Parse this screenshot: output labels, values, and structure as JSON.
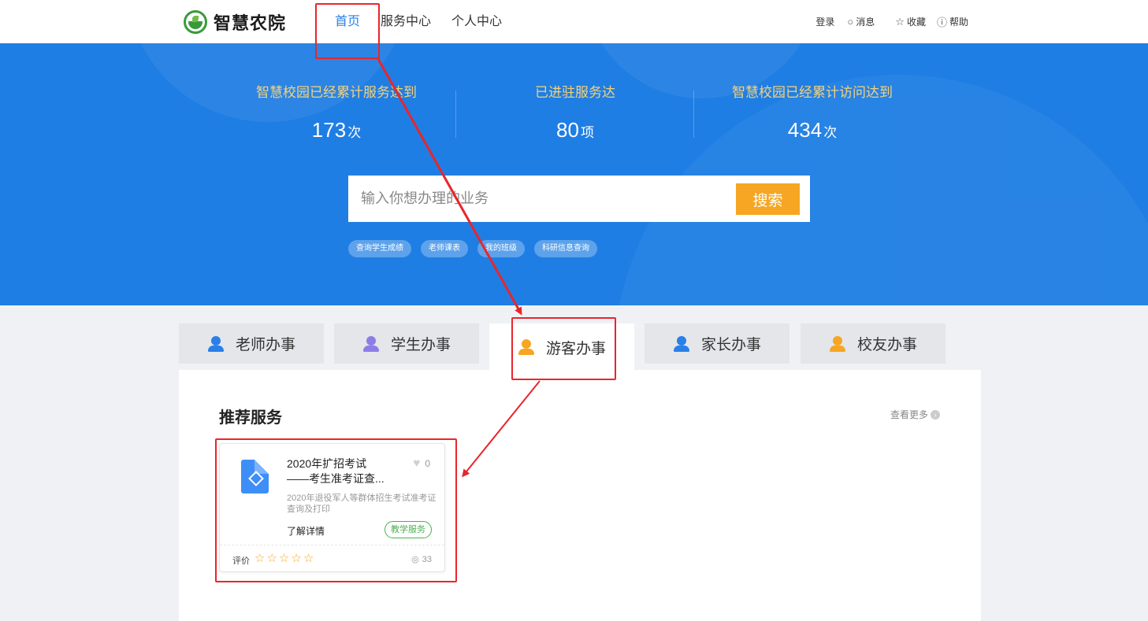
{
  "header": {
    "brand": "智慧农院",
    "nav": [
      "首页",
      "服务中心",
      "个人中心"
    ],
    "active_nav": 0,
    "tools": {
      "login": "登录",
      "message": "消息",
      "favorite": "收藏",
      "help": "帮助"
    }
  },
  "hero": {
    "stats": [
      {
        "label": "智慧校园已经累计服务达到",
        "value": "173",
        "unit": "次"
      },
      {
        "label": "已进驻服务达",
        "value": "80",
        "unit": "项"
      },
      {
        "label": "智慧校园已经累计访问达到",
        "value": "434",
        "unit": "次"
      }
    ],
    "search": {
      "placeholder": "输入你想办理的业务",
      "button": "搜索"
    },
    "tags": [
      "查询学生成绩",
      "老师课表",
      "我的班级",
      "科研信息查询"
    ]
  },
  "tabs": [
    {
      "label": "老师办事",
      "icon": "teacher-icon",
      "color": "blue"
    },
    {
      "label": "学生办事",
      "icon": "student-icon",
      "color": "purple"
    },
    {
      "label": "游客办事",
      "icon": "visitor-icon",
      "color": "orange"
    },
    {
      "label": "家长办事",
      "icon": "parent-icon",
      "color": "blue"
    },
    {
      "label": "校友办事",
      "icon": "alumni-icon",
      "color": "orange"
    }
  ],
  "active_tab": 2,
  "panel": {
    "title": "推荐服务",
    "more": "查看更多",
    "cards": [
      {
        "title_line1": "2020年扩招考试",
        "title_line2": "——考生准考证查...",
        "likes": "0",
        "description": "2020年退役军人等群体招生考试准考证查询及打印",
        "detail": "了解详情",
        "category": "教学服务",
        "rating_label": "评价",
        "rating": 0,
        "rating_max": 5,
        "views": "33"
      }
    ]
  },
  "colors": {
    "primary": "#1f7ee3",
    "accent": "#f6a623",
    "stat_label": "#f6d27a",
    "success": "#4caf50",
    "annotation": "#e8262b"
  }
}
